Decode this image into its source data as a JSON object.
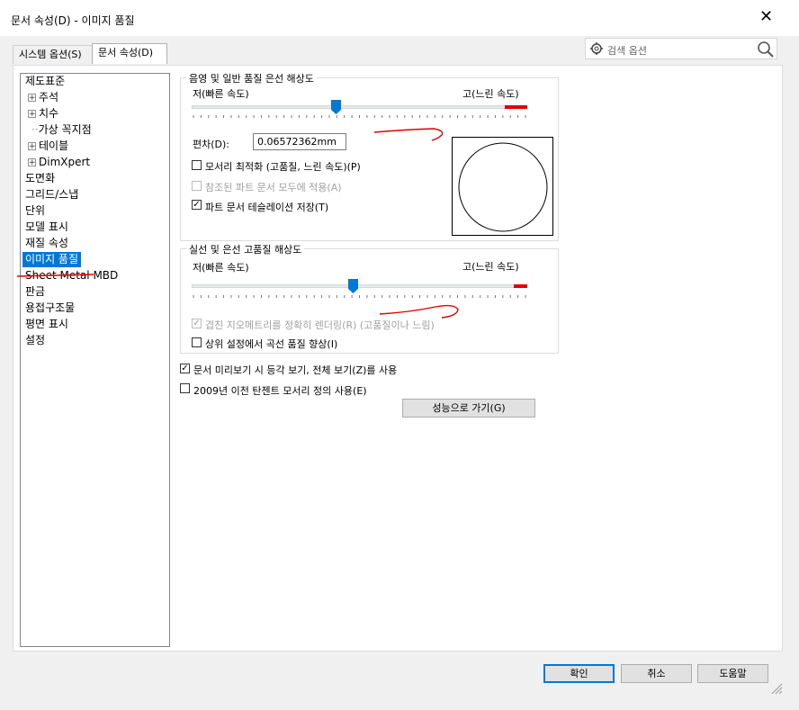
{
  "window": {
    "title": "문서 속성(D) - 이미지 품질",
    "close_glyph": "✕"
  },
  "tabs": [
    {
      "label": "시스템 옵션(S)"
    },
    {
      "label": "문서 속성(D)"
    }
  ],
  "search": {
    "placeholder": "검색 옵션",
    "icon": "gear-icon",
    "search_icon": "magnifier-icon"
  },
  "tree": {
    "items": [
      {
        "label": "제도표준"
      },
      {
        "label": "주석"
      },
      {
        "label": "치수"
      },
      {
        "label": "가상 꼭지점"
      },
      {
        "label": "테이블"
      },
      {
        "label": "DimXpert"
      },
      {
        "label": "도면화"
      },
      {
        "label": "그리드/스냅"
      },
      {
        "label": "단위"
      },
      {
        "label": "모델 표시"
      },
      {
        "label": "재질 속성"
      },
      {
        "label": "이미지 품질"
      },
      {
        "label": "Sheet Metal MBD"
      },
      {
        "label": "판금"
      },
      {
        "label": "용접구조물"
      },
      {
        "label": "평면 표시"
      },
      {
        "label": "설정"
      }
    ],
    "selected": "이미지 품질",
    "expand_glyph": "+"
  },
  "shaded": {
    "title": "음영 및 일반 품질 은선 해상도",
    "low_label": "저(빠른 속도)",
    "high_label": "고(느린 속도)",
    "slider_level": 0.43,
    "deviation_label": "편차(D):",
    "deviation_value": "0.06572362mm",
    "optimize_edge": {
      "label": "모서리 최적화 (고품질, 느린 속도)(P)",
      "checked": false
    },
    "apply_to_referenced": {
      "label": "참조된 파트 문서 모두에 적용(A)",
      "checked": false,
      "disabled": true
    },
    "save_tessellation": {
      "label": "파트 문서 테슬레이션 저장(T)",
      "checked": true
    },
    "check_glyph": "✓"
  },
  "wireframe": {
    "title": "실선 및 은선 고품질 해상도",
    "low_label": "저(빠른 속도)",
    "high_label": "고(느린 속도)",
    "slider_level": 0.48,
    "precise_render": {
      "label": "겹친 지오메트리를 정확히 렌더링(R) (고품질이나 느림)",
      "checked": true,
      "disabled": true
    },
    "optimize_curve": {
      "label": "상위 설정에서 곡선 품질 향상(I)",
      "checked": false
    }
  },
  "options": {
    "preview_iso": {
      "label": "문서 미리보기 시 등각 보기, 전체 보기(Z)를 사용",
      "checked": true
    },
    "pre2009_tangent": {
      "label": "2009년 이전 탄젠트 모서리 정의 사용(E)",
      "checked": false
    },
    "goto_performance": "성능으로 가기(G)"
  },
  "footer": {
    "ok": "확인",
    "cancel": "취소",
    "help": "도움말"
  },
  "colors": {
    "accent": "#0078d7",
    "annotation": "#e00000"
  }
}
